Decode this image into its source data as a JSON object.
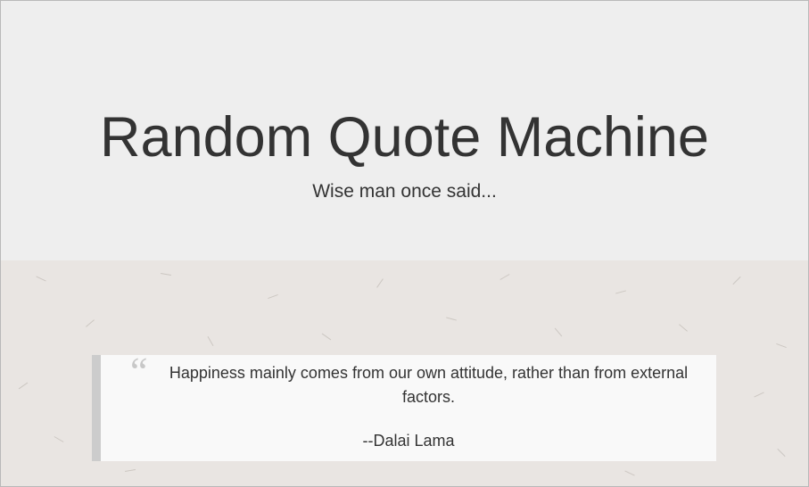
{
  "header": {
    "title": "Random Quote Machine",
    "subtitle": "Wise man once said..."
  },
  "quote": {
    "text": "Happiness mainly comes from our own attitude, rather than from external factors.",
    "author": "--Dalai Lama",
    "mark_icon": "quote-open-icon"
  },
  "colors": {
    "header_bg": "#eeeeee",
    "paper_bg": "#e9e5e2",
    "card_bg": "#f9f9f9",
    "accent_bar": "#cccccc",
    "text": "#333333"
  }
}
